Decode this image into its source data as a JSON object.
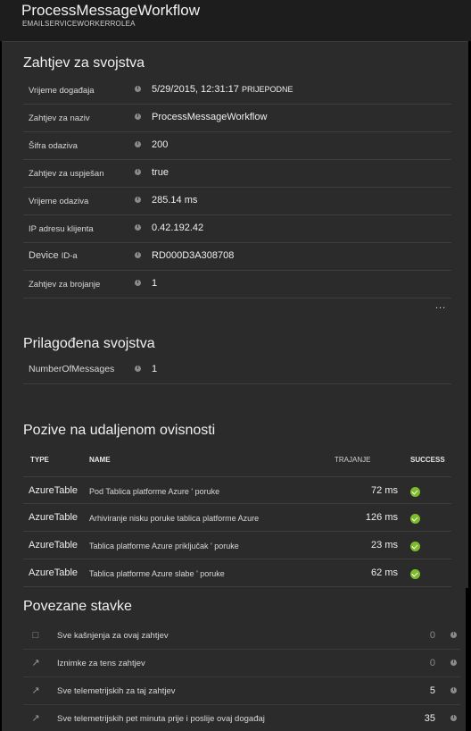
{
  "header": {
    "title": "ProcessMessageWorkflow",
    "subtitle": "EMAILSERVICEWORKERROLEA"
  },
  "request_properties": {
    "title": "Zahtjev za svojstva",
    "rows": [
      {
        "label": "Vrijeme događaja",
        "value": "5/29/2015, 12:31:17",
        "suffix": "PRIJEPODNE"
      },
      {
        "label": "Zahtjev za naziv",
        "value": "ProcessMessageWorkflow"
      },
      {
        "label": "Šifra odaziva",
        "value": "200"
      },
      {
        "label": "Zahtjev za uspješan",
        "value": "true"
      },
      {
        "label": "Vrijeme odaziva",
        "value": "285.14 ms"
      },
      {
        "label": "IP adresu klijenta",
        "value": "0.42.192.42"
      },
      {
        "label": "Device",
        "label_suffix": "ID-a",
        "value": "RD000D3A308708"
      },
      {
        "label": "Zahtjev za brojanje",
        "value": "1"
      }
    ],
    "more": "..."
  },
  "custom_properties": {
    "title": "Prilagođena svojstva",
    "rows": [
      {
        "label": "NumberOfMessages",
        "value": "1"
      }
    ]
  },
  "dependencies": {
    "title": "Pozive na udaljenom ovisnosti",
    "columns": {
      "type": "TYPE",
      "name": "NAME",
      "duration": "TRAJANJE",
      "success": "SUCCESS"
    },
    "rows": [
      {
        "type": "AzureTable",
        "name": "Pod Tablica platforme Azure ' poruke",
        "duration": "72 ms"
      },
      {
        "type": "AzureTable",
        "name": "Arhiviranje nisku poruke tablica platforme Azure",
        "duration": "126 ms"
      },
      {
        "type": "AzureTable",
        "name": "Tablica platforme Azure priključak ' poruke",
        "duration": "23 ms"
      },
      {
        "type": "AzureTable",
        "name": "Tablica platforme Azure slabe ' poruke",
        "duration": "62 ms"
      }
    ]
  },
  "related": {
    "title": "Povezane stavke",
    "rows": [
      {
        "icon": "document-icon",
        "label": "Sve kašnjenja za ovaj zahtjev",
        "count": "0"
      },
      {
        "icon": "arrow-icon",
        "label": "Iznimke za tens zahtjev",
        "count": "0"
      },
      {
        "icon": "arrow-icon",
        "label": "Sve telemetrijskih za taj zahtjev",
        "count": "5"
      },
      {
        "icon": "arrow-icon",
        "label": "Sve telemetrijskih pet minuta prije i poslije ovaj događaj",
        "count": "35"
      }
    ]
  },
  "colors": {
    "success": "#7cbb2a",
    "panel": "#2b2b2b",
    "header": "#1d1d1d"
  }
}
